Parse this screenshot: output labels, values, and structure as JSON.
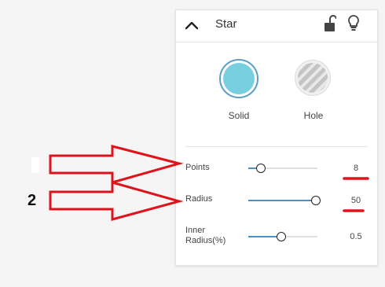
{
  "panel": {
    "title": "Star",
    "icons": {
      "collapse": "chevron-up-icon",
      "lock": "unlock-icon",
      "bulb": "lightbulb-icon"
    }
  },
  "shapes": [
    {
      "label": "Solid",
      "selected": true,
      "color": "#78cfe0"
    },
    {
      "label": "Hole",
      "selected": false
    }
  ],
  "params": [
    {
      "label": "Points",
      "value": "8",
      "fraction": 0.18
    },
    {
      "label": "Radius",
      "value": "50",
      "fraction": 0.98
    },
    {
      "label": "Inner Radius(%)",
      "label_line1": "Inner",
      "label_line2": "Radius(%)",
      "value": "0.5",
      "fraction": 0.48
    }
  ],
  "annotations": {
    "marker1": "",
    "marker2": "2",
    "arrow_color": "#e0121b"
  }
}
